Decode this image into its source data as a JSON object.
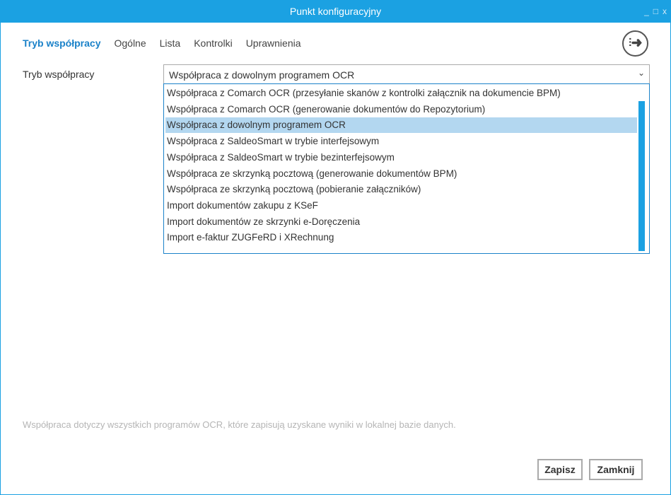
{
  "window": {
    "title": "Punkt konfiguracyjny",
    "controls": [
      "_",
      "□",
      "x"
    ]
  },
  "tabs": [
    "Tryb współpracy",
    "Ogólne",
    "Lista",
    "Kontrolki",
    "Uprawnienia"
  ],
  "field": {
    "label": "Tryb współpracy",
    "value": "Współpraca z dowolnym programem OCR"
  },
  "options": [
    "Współpraca z Comarch OCR (przesyłanie skanów z kontrolki załącznik na dokumencie BPM)",
    "Współpraca z Comarch OCR (generowanie dokumentów do Repozytorium)",
    "Współpraca z dowolnym programem OCR",
    "Współpraca z SaldeoSmart w trybie interfejsowym",
    "Współpraca z SaldeoSmart w trybie bezinterfejsowym",
    "Współpraca ze skrzynką pocztową (generowanie dokumentów BPM)",
    "Współpraca ze skrzynką pocztową (pobieranie załączników)",
    "Import dokumentów zakupu z KSeF",
    "Import dokumentów ze skrzynki e-Doręczenia",
    "Import e-faktur ZUGFeRD i XRechnung"
  ],
  "selected_index": 2,
  "hint": "Współpraca dotyczy wszystkich programów OCR, które zapisują uzyskane wyniki w lokalnej bazie danych.",
  "buttons": {
    "save": "Zapisz",
    "close": "Zamknij"
  }
}
